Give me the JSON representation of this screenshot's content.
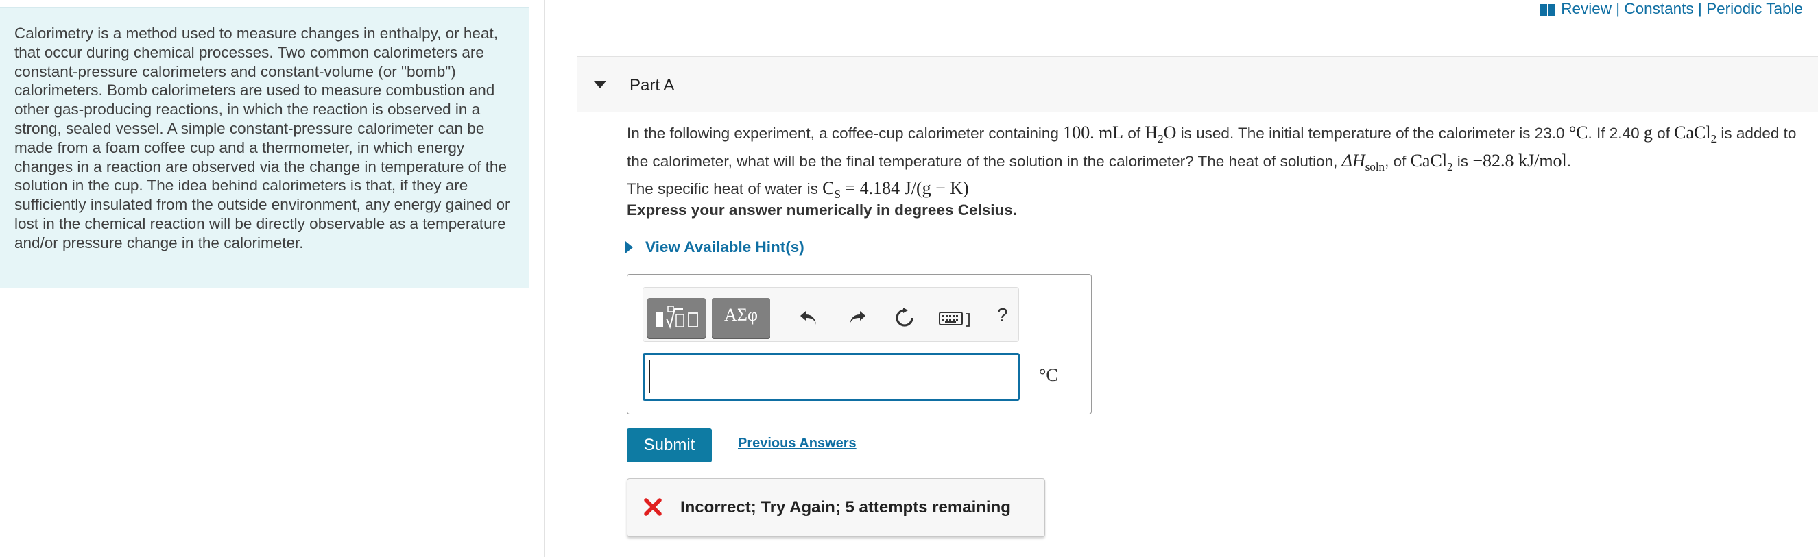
{
  "intro": {
    "text": "Calorimetry is a method used to measure changes in enthalpy, or heat, that occur during chemical processes. Two common calorimeters are constant-pressure calorimeters and constant-volume (or \"bomb\") calorimeters. Bomb calorimeters are used to measure combustion and other gas-producing reactions, in which the reaction is observed in a strong, sealed vessel. A simple constant-pressure calorimeter can be made from a foam coffee cup and a thermometer, in which energy changes in a reaction are observed via the change in temperature of the solution in the cup. The idea behind calorimeters is that, if they are sufficiently insulated from the outside environment, any energy gained or lost in the chemical reaction will be directly observable as a temperature and/or pressure change in the calorimeter."
  },
  "top_links": {
    "icon": "book-icon",
    "review": "Review",
    "separator": "|",
    "constants": "Constants",
    "periodic_table": "Periodic Table"
  },
  "part": {
    "title": "Part A"
  },
  "question": {
    "s1": "In the following experiment, a coffee-cup calorimeter containing ",
    "vol_value": "100.",
    "vol_unit": "mL",
    "s2": " of ",
    "water_h": "H",
    "water_sub": "2",
    "water_o": "O",
    "s3": " is used. The initial temperature of the calorimeter is 23.0 ",
    "temp_unit": "°C",
    "s4": ". If 2.40 ",
    "mass_unit": "g",
    "s5": " of ",
    "salt_a": "CaCl",
    "salt_sub": "2",
    "s6": " is added to the calorimeter, what will be the final temperature of the solution in the calorimeter? The heat of solution, ",
    "dh": "ΔH",
    "dh_sub": "soln",
    "s7": ", of ",
    "salt2_a": "CaCl",
    "salt2_sub": "2",
    "s8": " is ",
    "dh_value": "−82.8 kJ/mol",
    "s9": ".",
    "s10": "The specific heat of water is ",
    "cs": "C",
    "cs_sub": "S",
    "cs_value": " = 4.184 J/(g − K)"
  },
  "instructions": "Express your answer numerically in degrees Celsius.",
  "hint_label": "View Available Hint(s)",
  "toolbar": {
    "templates_icon": "math-templates-icon",
    "symbols_label": "ΑΣφ",
    "undo_icon": "undo-icon",
    "redo_icon": "redo-icon",
    "reset_icon": "reset-icon",
    "keyboard_icon": "keyboard-icon",
    "help_label": "?"
  },
  "answer": {
    "value": "",
    "unit": "°C"
  },
  "submit_label": "Submit",
  "previous_answers_label": "Previous Answers",
  "feedback": {
    "icon": "incorrect-x-icon",
    "message": "Incorrect; Try Again; 5 attempts remaining",
    "color": "#e02020"
  },
  "colors": {
    "accent": "#0f6fa3",
    "submit": "#0e7ba3",
    "intro_bg": "#e6f5f7"
  }
}
